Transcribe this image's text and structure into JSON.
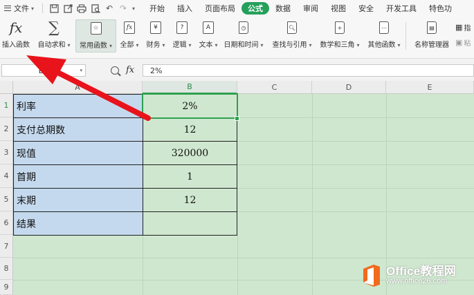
{
  "menu": {
    "file_label": "文件",
    "tabs": [
      "开始",
      "插入",
      "页面布局",
      "公式",
      "数据",
      "审阅",
      "视图",
      "安全",
      "开发工具",
      "特色功"
    ],
    "active_tab": "公式"
  },
  "ribbon": {
    "insert_function": "插入函数",
    "autosum": "自动求和",
    "common_functions": "常用函数",
    "all": "全部",
    "finance": "财务",
    "logic": "逻辑",
    "text": "文本",
    "datetime": "日期和时间",
    "lookup": "查找与引用",
    "math": "数学和三角",
    "other": "其他函数",
    "name_manager": "名称管理器",
    "paste_partial": "粘",
    "pin_partial": "指"
  },
  "formula_bar": {
    "name_box": "B1",
    "fx_label": "fx",
    "formula": "2%"
  },
  "sheet": {
    "columns": [
      "A",
      "B",
      "C",
      "D",
      "E"
    ],
    "rows": [
      "1",
      "2",
      "3",
      "4",
      "5",
      "6",
      "7",
      "8",
      "9"
    ],
    "table": [
      {
        "label": "利率",
        "value": "2%"
      },
      {
        "label": "支付总期数",
        "value": "12"
      },
      {
        "label": "现值",
        "value": "320000"
      },
      {
        "label": "首期",
        "value": "1"
      },
      {
        "label": "末期",
        "value": "12"
      },
      {
        "label": "结果",
        "value": ""
      }
    ],
    "selected_cell": "B1"
  },
  "watermark": {
    "line1": "Office教程网",
    "line2": "www.office26.com"
  },
  "colors": {
    "accent_green": "#24a05b",
    "label_fill": "#c5d9ee",
    "grid_fill": "#cfe7cf",
    "arrow_red": "#e8131b",
    "logo_orange": "#f26a1b"
  }
}
